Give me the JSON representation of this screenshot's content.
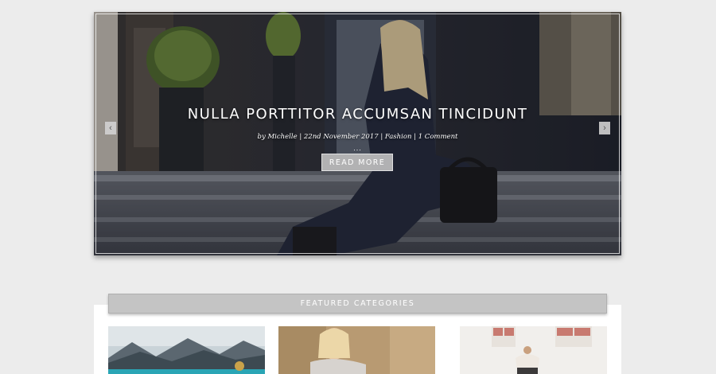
{
  "slider": {
    "title": "NULLA PORTTITOR ACCUMSAN TINCIDUNT",
    "meta": "by Michelle | 22nd November 2017 | Fashion | 1 Comment",
    "dots": "...",
    "read_more_label": "READ MORE",
    "prev_icon": "chevron-left-icon",
    "next_icon": "chevron-right-icon"
  },
  "featured": {
    "heading": "FEATURED CATEGORIES"
  }
}
